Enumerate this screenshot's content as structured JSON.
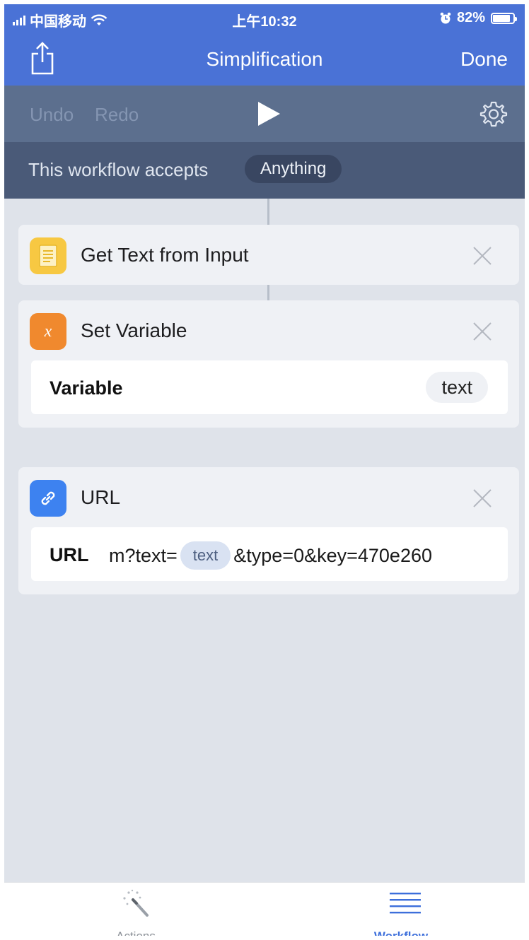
{
  "status": {
    "carrier": "中国移动",
    "time": "上午10:32",
    "battery": "82%"
  },
  "nav": {
    "title": "Simplification",
    "done_label": "Done"
  },
  "toolbar": {
    "undo_label": "Undo",
    "redo_label": "Redo"
  },
  "accepts": {
    "label": "This workflow accepts",
    "value": "Anything"
  },
  "actions": [
    {
      "title": "Get Text from Input",
      "icon": "text-document-icon",
      "color": "#f7c842"
    },
    {
      "title": "Set Variable",
      "icon": "variable-x-icon",
      "color": "#f0892e",
      "param": {
        "name": "Variable",
        "value": "text"
      }
    },
    {
      "title": "URL",
      "icon": "link-icon",
      "color": "#3d82f0",
      "param": {
        "name": "URL",
        "prefix": "m?text=",
        "variable": "text",
        "suffix": "&type=0&key=470e260"
      }
    }
  ],
  "tabbar": {
    "actions_label": "Actions",
    "workflow_label": "Workflow",
    "active": "Workflow",
    "active_color": "#3d6fdb"
  }
}
